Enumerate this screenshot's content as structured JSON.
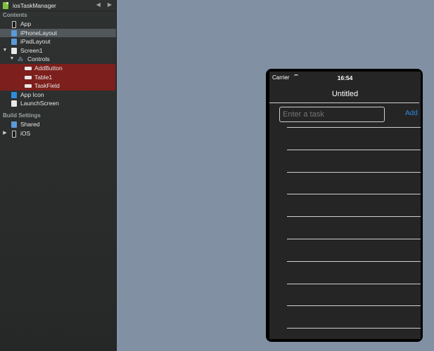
{
  "sidebar": {
    "project_title": "iosTaskManager",
    "nav_back": "◀",
    "nav_forward": "▶",
    "contents_header": "Contents",
    "items": [
      {
        "label": "App",
        "level": 1
      },
      {
        "label": "iPhoneLayout",
        "level": 1,
        "selected": true
      },
      {
        "label": "iPadLayout",
        "level": 1
      },
      {
        "label": "Screen1",
        "level": 0,
        "expanded": true
      },
      {
        "label": "Controls",
        "level": 1,
        "expanded": true
      },
      {
        "label": "AddButton",
        "level": 2
      },
      {
        "label": "Table1",
        "level": 2
      },
      {
        "label": "TaskField",
        "level": 2
      },
      {
        "label": "App Icon",
        "level": 1
      },
      {
        "label": "LaunchScreen",
        "level": 1
      }
    ],
    "build_header": "Build Settings",
    "build_items": [
      {
        "label": "Shared",
        "level": 1
      },
      {
        "label": "iOS",
        "level": 0,
        "expanded": false
      }
    ],
    "tri_open": "▼",
    "tri_closed": "▶"
  },
  "phone": {
    "carrier": "Carrier",
    "time": "16:54",
    "title": "Untitled",
    "task_placeholder": "Enter a task",
    "add_label": "Add",
    "table_rows": 10
  },
  "colors": {
    "canvas": "#8190a3",
    "selected_control": "#7d1f1c",
    "accent": "#2e88e8"
  }
}
